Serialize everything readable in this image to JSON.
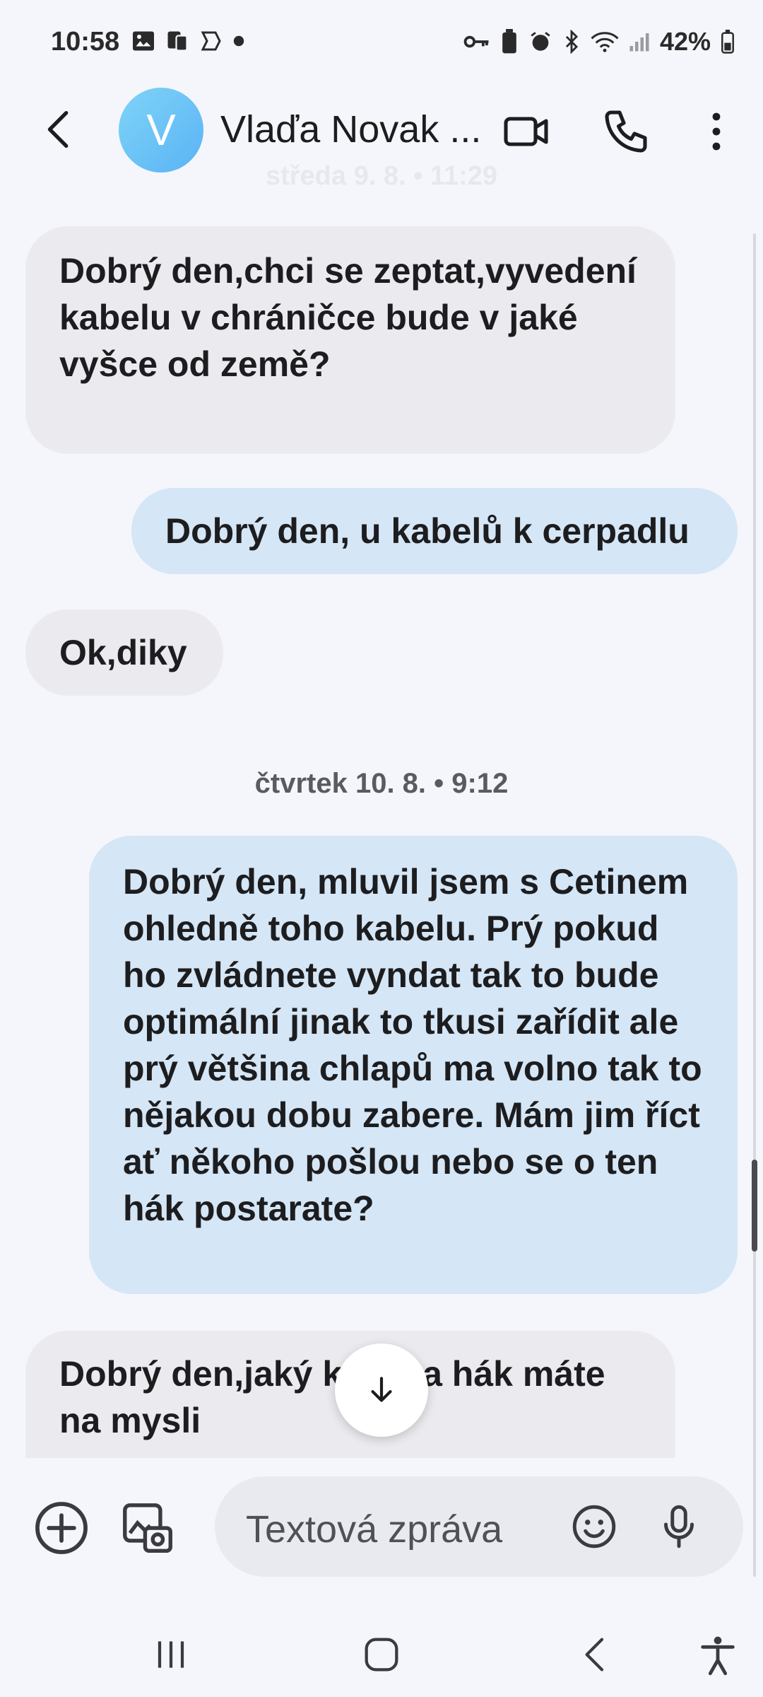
{
  "status_bar": {
    "time": "10:58",
    "battery": "42%"
  },
  "header": {
    "avatar_letter": "V",
    "contact_name": "Vlaďa Novak ..."
  },
  "ghost_date": "středa 9. 8. • 11:29",
  "messages": [
    {
      "direction": "incoming",
      "text": "Dobrý den,chci se zeptat,vyvedení kabelu v chráničce bude v jaké vyšce od země?"
    },
    {
      "direction": "outgoing",
      "text": "Dobrý den, u kabelů k cerpadlu"
    },
    {
      "direction": "incoming",
      "text": "Ok,diky"
    },
    {
      "direction": "outgoing",
      "text": "Dobrý den,  mluvil jsem s Cetinem ohledně toho kabelu. Prý pokud ho zvládnete vyndat tak to bude optimální jinak to tkusi zařídit ale prý většina chlapů ma volno tak to nějakou dobu zabere. Mám jim říct ať někoho pošlou nebo se o ten hák postarate?"
    },
    {
      "direction": "incoming",
      "text": "Dobrý den,jaký kabel a hák máte na mysli"
    }
  ],
  "date_separator": "čtvrtek 10. 8. • 9:12",
  "composer": {
    "placeholder": "Textová zpráva"
  },
  "colors": {
    "incoming_bubble": "#ebebef",
    "outgoing_bubble": "#d5e6f6",
    "avatar": "#6ec3f6",
    "background": "#f5f6fb"
  }
}
